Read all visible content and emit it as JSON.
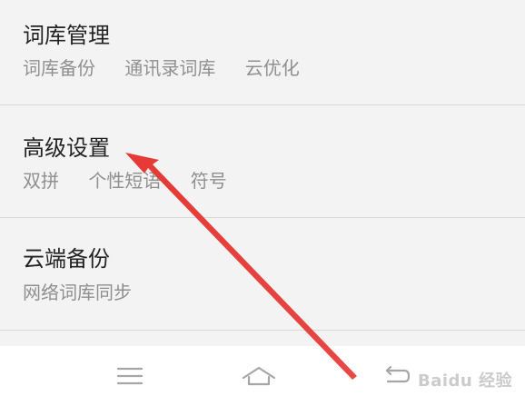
{
  "settings": {
    "items": [
      {
        "title": "词库管理",
        "subtitle_parts": [
          "词库备份",
          "通讯录词库",
          "云优化"
        ]
      },
      {
        "title": "高级设置",
        "subtitle_parts": [
          "双拼",
          "个性短语",
          "符号"
        ]
      },
      {
        "title": "云端备份",
        "subtitle_parts": [
          "网络词库同步"
        ]
      }
    ]
  },
  "navigation": {
    "buttons": [
      {
        "name": "menu",
        "icon": "menu-icon"
      },
      {
        "name": "home",
        "icon": "home-icon"
      },
      {
        "name": "back",
        "icon": "back-icon"
      }
    ]
  },
  "overlay": {
    "arrow_color": "#e53935",
    "watermark_text": "Baidu 经验"
  },
  "colors": {
    "background": "#f3f3f3",
    "title_text": "#232323",
    "subtitle_text": "#8f8f8f",
    "divider": "#d9d9d9",
    "nav_background": "#ffffff",
    "nav_icon": "#a6a6a6"
  }
}
